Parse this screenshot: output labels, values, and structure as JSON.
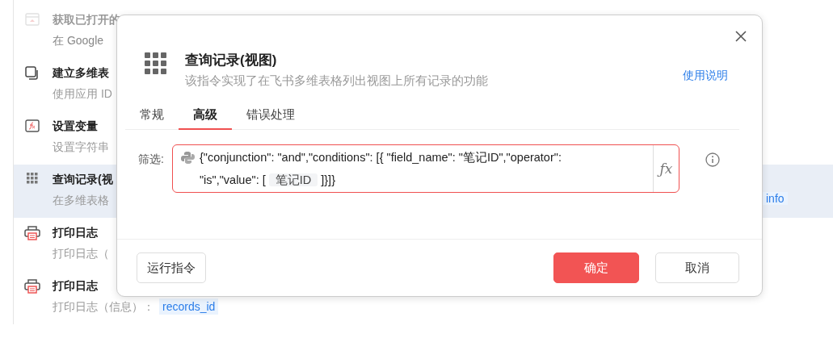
{
  "background_list": [
    {
      "kind": "browser",
      "title": "获取已打开的",
      "subtitle": "在 Google",
      "selected": false
    },
    {
      "kind": "copy",
      "title": "建立多维表",
      "subtitle": "使用应用 ID",
      "selected": false
    },
    {
      "kind": "function",
      "title": "设置变量",
      "subtitle": "设置字符串",
      "selected": false
    },
    {
      "kind": "grid",
      "title": "查询记录(视",
      "subtitle": "在多维表格",
      "tag": "info",
      "selected": true
    },
    {
      "kind": "printer",
      "title": "打印日志",
      "subtitle": "打印日志（",
      "selected": false
    },
    {
      "kind": "printer",
      "title": "打印日志",
      "subtitle": "打印日志（信息）：",
      "tag": "records_id",
      "selected": false
    }
  ],
  "dialog": {
    "title": "查询记录(视图)",
    "description": "该指令实现了在飞书多维表格列出视图上所有记录的功能",
    "help_link": "使用说明",
    "tabs": [
      {
        "label": "常规",
        "selected": false
      },
      {
        "label": "高级",
        "selected": true
      },
      {
        "label": "错误处理",
        "selected": false
      }
    ],
    "filter": {
      "label": "筛选:",
      "invalid": true,
      "parts": [
        {
          "kind": "text",
          "text": "{\"conjunction\": \"and\",\"conditions\": [{ \"field_name\": \"笔记ID\",\"operator\":"
        },
        {
          "kind": "text",
          "text": "\"is\",\"value\": ["
        },
        {
          "kind": "variable",
          "text": "笔记ID"
        },
        {
          "kind": "text",
          "text": "]}]}"
        }
      ],
      "formula_button": "ƒx"
    },
    "buttons": [
      {
        "label": "运行指令",
        "kind": "secondary"
      },
      {
        "label": "确定",
        "kind": "primary"
      },
      {
        "label": "取消",
        "kind": "secondary"
      }
    ]
  }
}
